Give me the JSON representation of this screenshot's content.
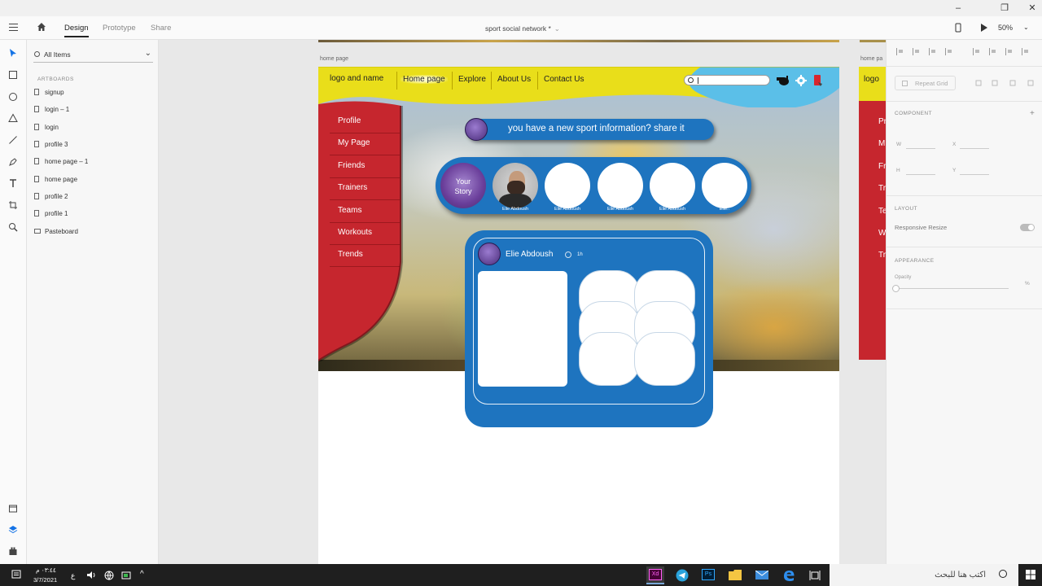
{
  "titlebar": {
    "min": "–",
    "restore": "❐",
    "close": "✕"
  },
  "menubar": {
    "tabs": [
      {
        "label": "Design",
        "active": true
      },
      {
        "label": "Prototype",
        "active": false
      },
      {
        "label": "Share",
        "active": false
      }
    ],
    "document_title": "sport social network *",
    "zoom": "50%"
  },
  "layers": {
    "filter": "All Items",
    "section": "ARTBOARDS",
    "items": [
      "signup",
      "login – 1",
      "login",
      "profile 3",
      "home page – 1",
      "home page",
      "profile 2",
      "profile 1",
      "Pasteboard"
    ]
  },
  "canvas": {
    "artboard_label": "home page",
    "artboard2_label": "home pa",
    "nav": {
      "logo": "logo and name",
      "links": [
        "Home page",
        "Explore",
        "About Us",
        "Contact Us"
      ]
    },
    "side_menu": [
      "Profile",
      "My Page",
      "Friends",
      "Trainers",
      "Teams",
      "Workouts",
      "Trends"
    ],
    "share_prompt": "you have a new sport information? share it",
    "stories": {
      "your_story_line1": "Your",
      "your_story_line2": "Story",
      "names": [
        "Elie Abdoush",
        "Elie Abdoush",
        "Elie Abdoush",
        "Elie Abdoush",
        "Elie.."
      ]
    },
    "post": {
      "author": "Elie Abdoush",
      "time": "1h"
    },
    "artboard2": {
      "logo": "logo",
      "menu": [
        "Pr",
        "M",
        "Fr",
        "Tr",
        "Te",
        "W",
        "Tr"
      ]
    }
  },
  "props": {
    "repeat_grid": "Repeat Grid",
    "component": "COMPONENT",
    "w_label": "W",
    "x_label": "X",
    "h_label": "H",
    "y_label": "Y",
    "layout": "LAYOUT",
    "responsive_resize": "Responsive Resize",
    "appearance": "APPEARANCE",
    "opacity": "Opacity",
    "opacity_value": "%"
  },
  "taskbar": {
    "search_placeholder": "اكتب هنا للبحث",
    "time": "٠٣:٤٤ م",
    "date": "3/7/2021",
    "lang": "ع",
    "apps": [
      "Xd",
      "Telegram",
      "Ps",
      "Files",
      "Mail",
      "Edge",
      "Task View"
    ]
  },
  "colors": {
    "nav_yellow": "#e9de1a",
    "sky": "#5bbfe8",
    "menu_red": "#c6262e",
    "card_blue": "#1e74bf"
  }
}
